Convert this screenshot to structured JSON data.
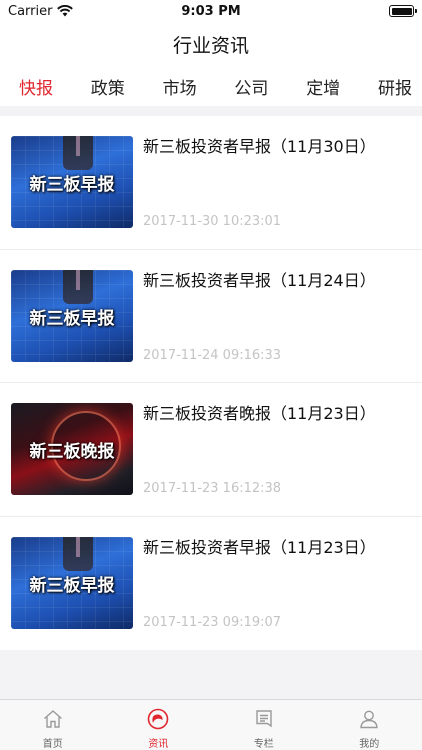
{
  "status_bar": {
    "carrier": "Carrier",
    "time": "9:03 PM"
  },
  "nav": {
    "title": "行业资讯"
  },
  "tabs": [
    {
      "label": "快报",
      "active": true
    },
    {
      "label": "政策",
      "active": false
    },
    {
      "label": "市场",
      "active": false
    },
    {
      "label": "公司",
      "active": false
    },
    {
      "label": "定增",
      "active": false
    },
    {
      "label": "研报",
      "active": false
    }
  ],
  "news": [
    {
      "title": "新三板投资者早报（11月30日）",
      "time": "2017-11-30 10:23:01",
      "thumb_caption": "新三板早报",
      "thumb_style": "blue"
    },
    {
      "title": "新三板投资者早报（11月24日）",
      "time": "2017-11-24 09:16:33",
      "thumb_caption": "新三板早报",
      "thumb_style": "blue"
    },
    {
      "title": "新三板投资者晚报（11月23日）",
      "time": "2017-11-23 16:12:38",
      "thumb_caption": "新三板晚报",
      "thumb_style": "red"
    },
    {
      "title": "新三板投资者早报（11月23日）",
      "time": "2017-11-23 09:19:07",
      "thumb_caption": "新三板早报",
      "thumb_style": "blue"
    }
  ],
  "tab_bar": [
    {
      "label": "首页",
      "icon": "home-icon",
      "active": false
    },
    {
      "label": "资讯",
      "icon": "news-icon",
      "active": true
    },
    {
      "label": "专栏",
      "icon": "column-icon",
      "active": false
    },
    {
      "label": "我的",
      "icon": "profile-icon",
      "active": false
    }
  ],
  "colors": {
    "accent": "#e0262e",
    "inactive_icon": "#9a9a9a"
  }
}
